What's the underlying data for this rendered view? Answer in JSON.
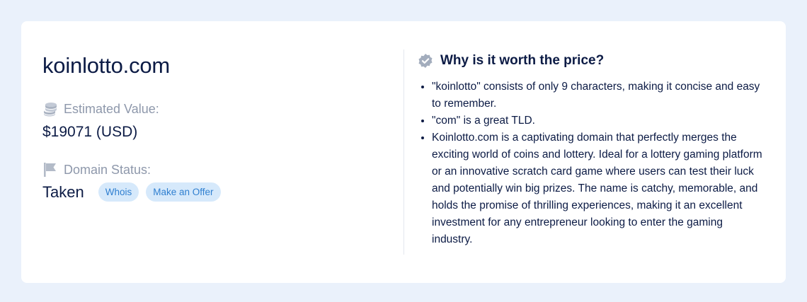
{
  "domain": {
    "name": "koinlotto.com"
  },
  "estimated_value": {
    "label": "Estimated Value:",
    "value": "$19071 (USD)",
    "icon": "coins-icon"
  },
  "domain_status": {
    "label": "Domain Status:",
    "value": "Taken",
    "icon": "flag-icon",
    "actions": {
      "whois": "Whois",
      "offer": "Make an Offer"
    }
  },
  "why": {
    "heading": "Why is it worth the price?",
    "icon": "verified-badge-icon",
    "reasons": [
      "\"koinlotto\" consists of only 9 characters, making it concise and easy to remember.",
      "\"com\" is a great TLD.",
      "Koinlotto.com is a captivating domain that perfectly merges the exciting world of coins and lottery. Ideal for a lottery gaming platform or an innovative scratch card game where users can test their luck and potentially win big prizes. The name is catchy, memorable, and holds the promise of thrilling experiences, making it an excellent investment for any entrepreneur looking to enter the gaming industry."
    ]
  },
  "colors": {
    "page_background": "#eaf1fb",
    "card_background": "#ffffff",
    "text_primary": "#0c1b45",
    "text_muted": "#8e98ab",
    "pill_background": "#d6e9fb",
    "pill_text": "#2f7fd0"
  }
}
